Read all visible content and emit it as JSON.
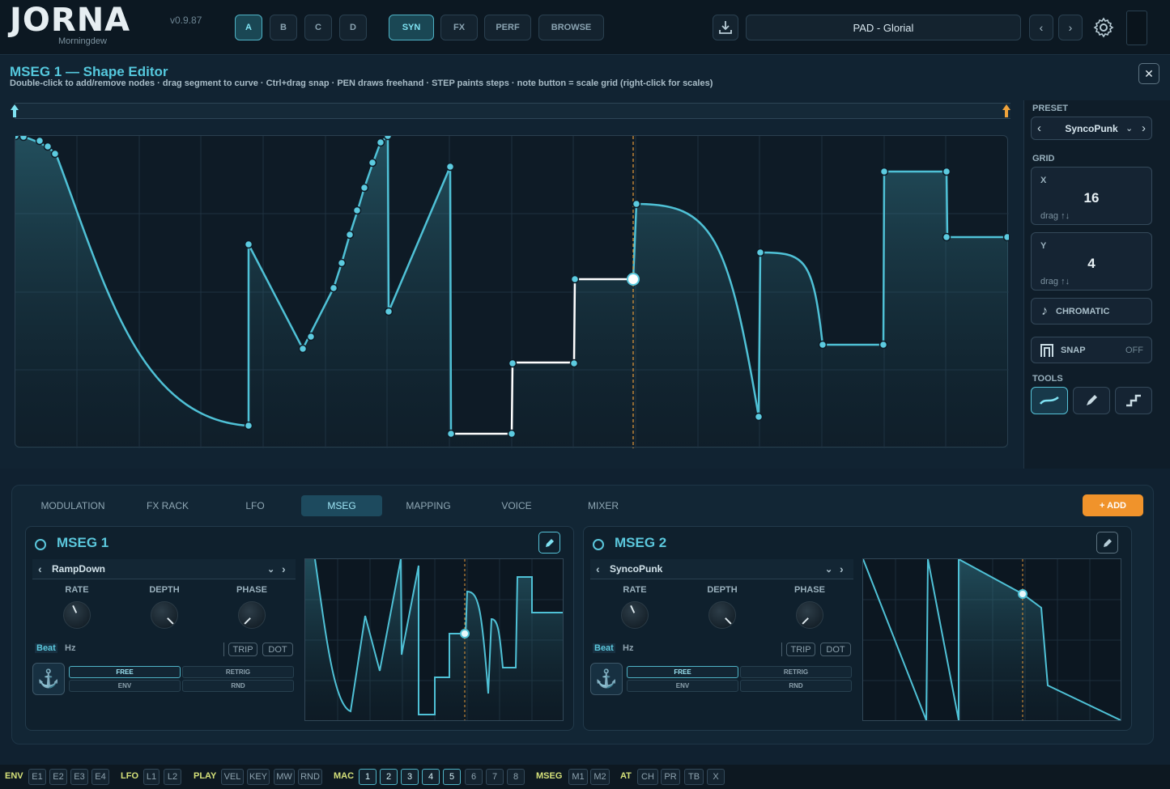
{
  "header": {
    "logo": "JORNA",
    "version": "v0.9.87",
    "subtitle": "Morningdew",
    "slots": [
      "A",
      "B",
      "C",
      "D"
    ],
    "views": [
      "SYN",
      "FX",
      "PERF",
      "BROWSE"
    ],
    "preset_name": "PAD - Glorial"
  },
  "editor": {
    "title": "MSEG 1 — Shape Editor",
    "hint": "Double-click to add/remove nodes · drag segment to curve · Ctrl+drag snap · PEN draws freehand · STEP paints steps · note button = scale grid (right-click for scales)",
    "close": "✕"
  },
  "side": {
    "preset_label": "PRESET",
    "preset_value": "SyncoPunk",
    "grid_label": "GRID",
    "x_label": "X",
    "x_value": "16",
    "y_label": "Y",
    "y_value": "4",
    "drag_hint": "drag ↑↓",
    "chromatic": "CHROMATIC",
    "snap_label": "SNAP",
    "snap_value": "OFF",
    "tools_label": "TOOLS"
  },
  "bottom": {
    "tabs": [
      "MODULATION",
      "FX RACK",
      "LFO",
      "MSEG",
      "MAPPING",
      "VOICE",
      "MIXER"
    ],
    "active_tab": "MSEG",
    "add": "+ ADD",
    "cards": [
      {
        "title": "MSEG 1",
        "shape": "RampDown",
        "rate": "RATE",
        "depth": "DEPTH",
        "phase": "PHASE",
        "beat": "Beat",
        "hz": "Hz",
        "trip": "TRIP",
        "dot": "DOT",
        "free": "FREE",
        "retrig": "RETRIG",
        "env": "ENV",
        "rnd": "RND"
      },
      {
        "title": "MSEG 2",
        "shape": "SyncoPunk",
        "rate": "RATE",
        "depth": "DEPTH",
        "phase": "PHASE",
        "beat": "Beat",
        "hz": "Hz",
        "trip": "TRIP",
        "dot": "DOT",
        "free": "FREE",
        "retrig": "RETRIG",
        "env": "ENV",
        "rnd": "RND"
      }
    ]
  },
  "footer": {
    "env_label": "ENV",
    "env": [
      "E1",
      "E2",
      "E3",
      "E4"
    ],
    "lfo_label": "LFO",
    "lfo": [
      "L1",
      "L2"
    ],
    "play_label": "PLAY",
    "play": [
      "VEL",
      "KEY",
      "MW",
      "RND"
    ],
    "mac_label": "MAC",
    "mac": [
      "1",
      "2",
      "3",
      "4",
      "5",
      "6",
      "7",
      "8"
    ],
    "mseg_label": "MSEG",
    "mseg": [
      "M1",
      "M2"
    ],
    "at_label": "AT",
    "at": [
      "CH",
      "PR",
      "TB",
      "X"
    ]
  },
  "colors": {
    "accent": "#5bc7dc",
    "orange": "#f0932b",
    "footer_label": "#d6e27a"
  }
}
